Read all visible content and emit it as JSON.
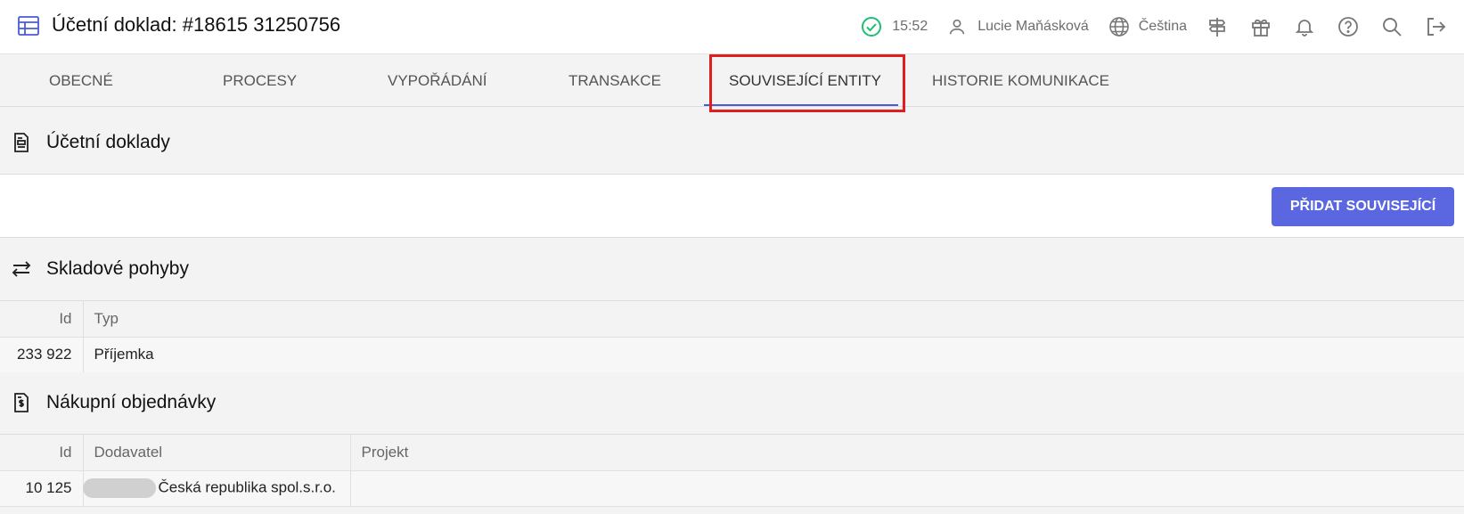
{
  "header": {
    "title": "Účetní doklad: #18615 31250756",
    "time": "15:52",
    "user_name": "Lucie Maňásková",
    "language": "Čeština",
    "accent_color": "#5a67e0",
    "status_color": "#1dbf73",
    "icons": [
      "table-icon",
      "check-circle-icon",
      "user-icon",
      "globe-icon",
      "signpost-icon",
      "gift-icon",
      "bell-icon",
      "help-icon",
      "search-icon",
      "logout-icon"
    ]
  },
  "tabs": [
    {
      "label": "OBECNÉ"
    },
    {
      "label": "PROCESY"
    },
    {
      "label": "VYPOŘÁDÁNÍ"
    },
    {
      "label": "TRANSAKCE"
    },
    {
      "label": "SOUVISEJÍCÍ ENTITY",
      "active": true
    },
    {
      "label": "HISTORIE KOMUNIKACE"
    }
  ],
  "sections": {
    "accounting": {
      "title": "Účetní doklady"
    },
    "add_button": "PŘIDAT SOUVISEJÍCÍ",
    "stock": {
      "title": "Skladové pohyby",
      "columns": [
        "Id",
        "Typ"
      ],
      "rows": [
        {
          "id": "233 922",
          "type": "Příjemka"
        }
      ]
    },
    "orders": {
      "title": "Nákupní objednávky",
      "columns": [
        "Id",
        "Dodavatel",
        "Projekt"
      ],
      "rows": [
        {
          "id": "10 125",
          "supplier": "Česká republika spol.s.r.o.",
          "project": ""
        }
      ]
    }
  }
}
